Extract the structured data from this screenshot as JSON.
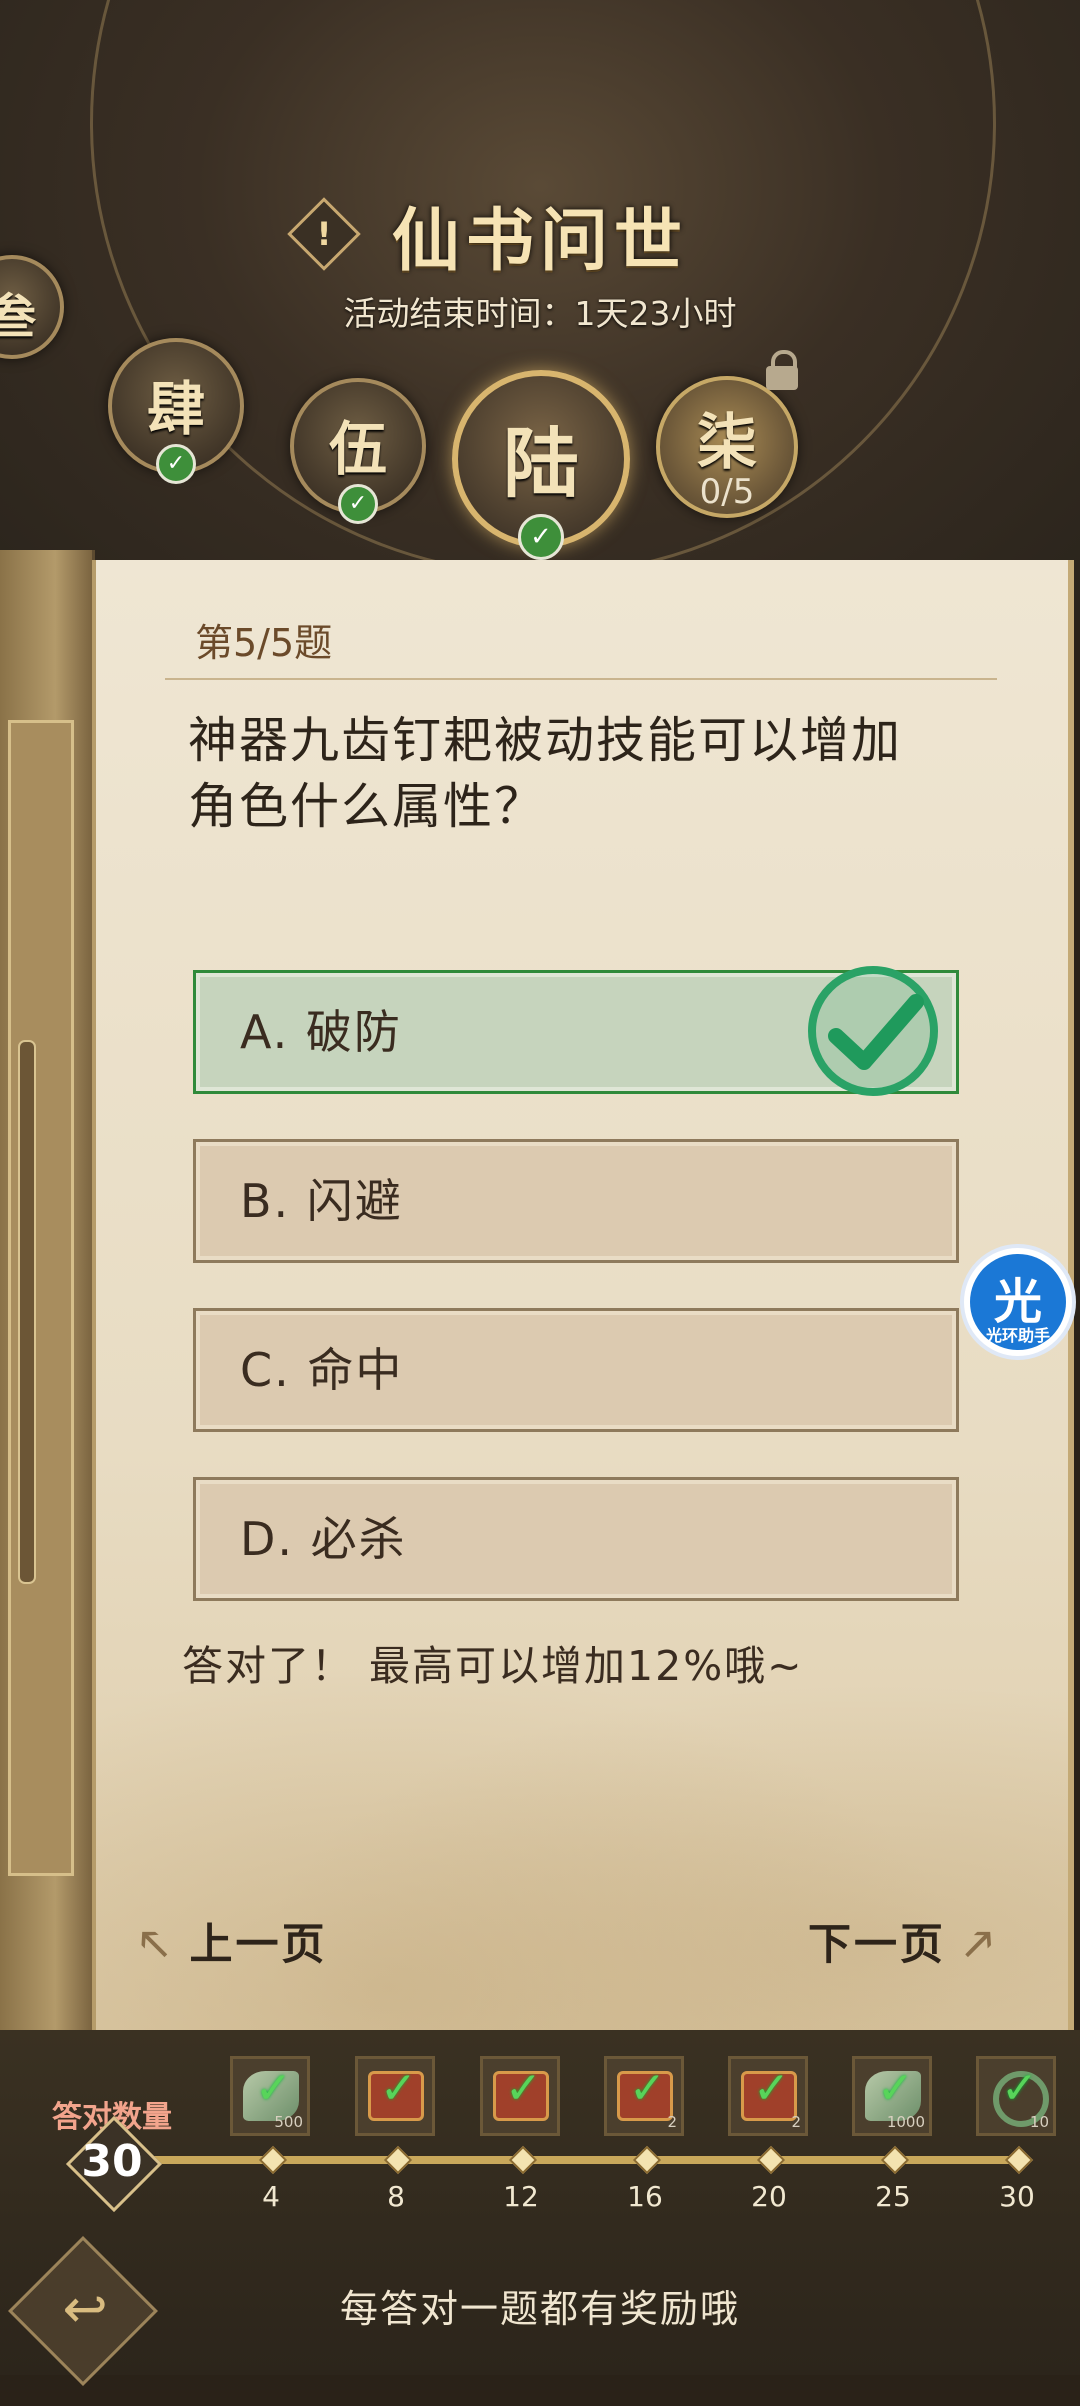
{
  "header": {
    "title": "仙书问世",
    "notice_icon": "!",
    "end_time": "活动结束时间：1天23小时"
  },
  "chapters": [
    {
      "label": "叁",
      "done": true
    },
    {
      "label": "肆",
      "done": true
    },
    {
      "label": "伍",
      "done": true
    },
    {
      "label": "陆",
      "done": true,
      "active": true
    },
    {
      "label": "柒",
      "done": false,
      "locked": true,
      "progress": "0/5"
    }
  ],
  "quiz": {
    "number": "第5/5题",
    "question_line1": "神器九齿钉耙被动技能可以增加",
    "question_line2": "角色什么属性？",
    "options": [
      {
        "label": "A. 破防",
        "correct": true
      },
      {
        "label": "B. 闪避",
        "correct": false
      },
      {
        "label": "C. 命中",
        "correct": false
      },
      {
        "label": "D. 必杀",
        "correct": false
      }
    ],
    "feedback": "答对了！ 最高可以增加12%哦~"
  },
  "nav": {
    "prev": "上一页",
    "next": "下一页"
  },
  "progress": {
    "label": "答对数量",
    "count": "30",
    "milestones": [
      "4",
      "8",
      "12",
      "16",
      "20",
      "25",
      "30"
    ],
    "rewards": [
      {
        "type": "feather",
        "count": "500",
        "claimed": true
      },
      {
        "type": "chest",
        "count": "",
        "claimed": true
      },
      {
        "type": "chest",
        "count": "",
        "claimed": true
      },
      {
        "type": "chest",
        "count": "2",
        "claimed": true
      },
      {
        "type": "chest",
        "count": "2",
        "claimed": true
      },
      {
        "type": "feather",
        "count": "1000",
        "claimed": true
      },
      {
        "type": "ring",
        "count": "10",
        "claimed": true
      }
    ]
  },
  "footer": {
    "tip": "每答对一题都有奖励哦"
  },
  "overlay": {
    "helper_glyph": "光",
    "helper_label": "光环助手"
  },
  "colors": {
    "correct": "#2f8a3a",
    "gold": "#d8b56e",
    "paper": "#e8dcc3"
  }
}
